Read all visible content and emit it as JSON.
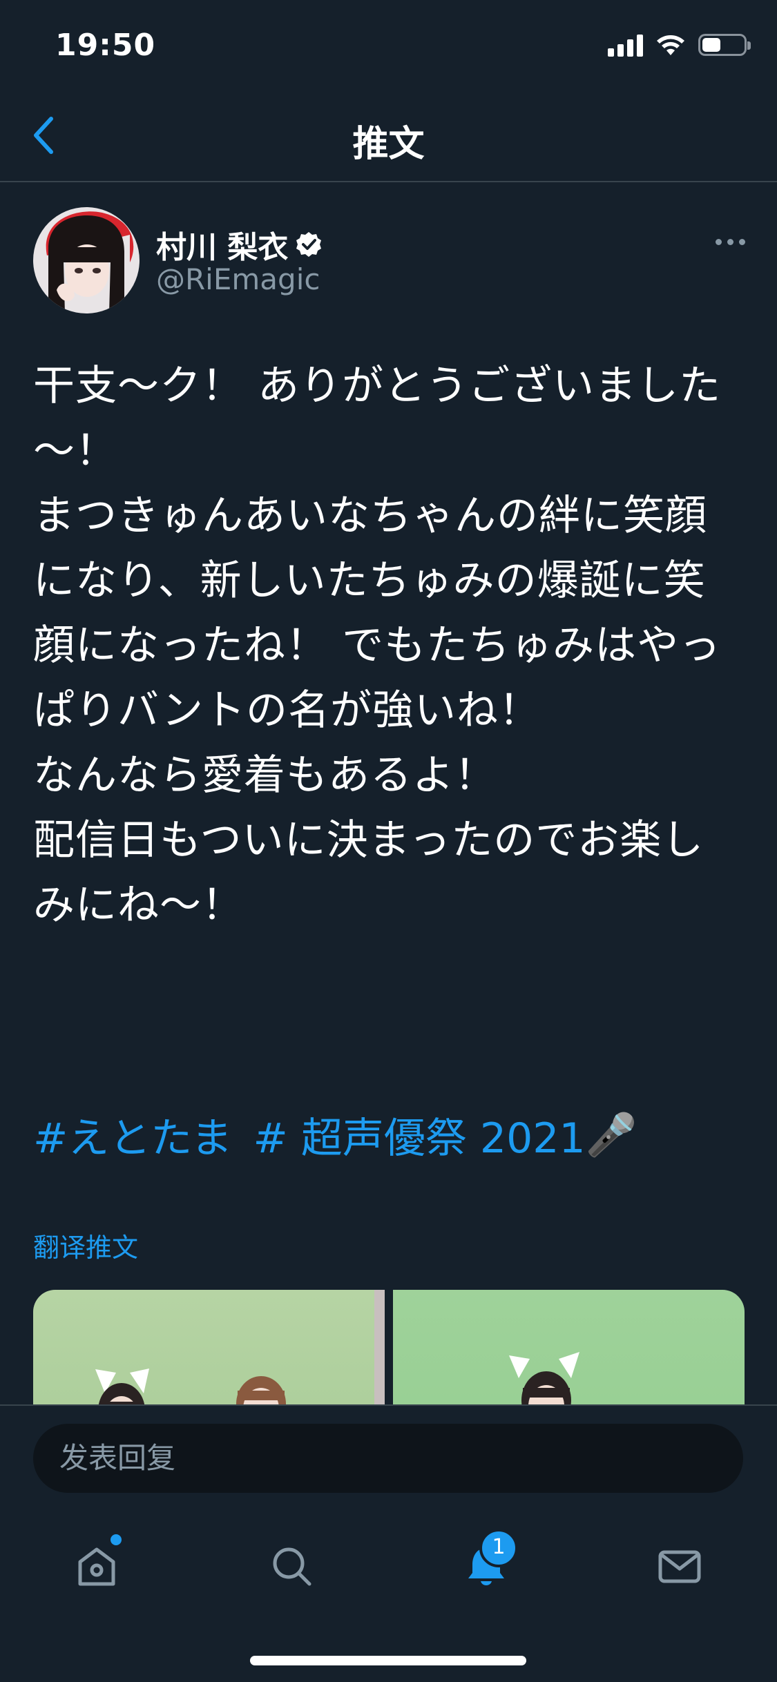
{
  "status_bar": {
    "time": "19:50",
    "battery_level": 0.45
  },
  "nav": {
    "title": "推文",
    "back_icon": "chevron-left-icon"
  },
  "tweet": {
    "author_name": "村川 梨衣",
    "author_handle": "@RiEmagic",
    "verified": true,
    "text": "干支～ク！ ありがとうございました～！\nまつきゅんあいなちゃんの絆に笑顔になり、新しいたちゅみの爆誕に笑顔になったね！ でもたちゅみはやっぱりバントの名が強いね！\nなんなら愛着もあるよ！\n配信日もついに決まったのでお楽しみにね～！",
    "hashtags": [
      "#えとたま",
      "# 超声優祭 2021"
    ],
    "hashtag_emoji": "🎤",
    "translate_label": "翻译推文"
  },
  "reply": {
    "placeholder": "发表回复"
  },
  "tabs": [
    {
      "name": "home",
      "icon": "home-icon",
      "has_dot": true
    },
    {
      "name": "search",
      "icon": "search-icon"
    },
    {
      "name": "notifications",
      "icon": "bell-icon",
      "badge": "1",
      "active": true
    },
    {
      "name": "messages",
      "icon": "mail-icon"
    }
  ],
  "colors": {
    "background": "#15202b",
    "accent": "#1d9bf0",
    "secondary_text": "#8899a6",
    "divider": "#38444d"
  }
}
